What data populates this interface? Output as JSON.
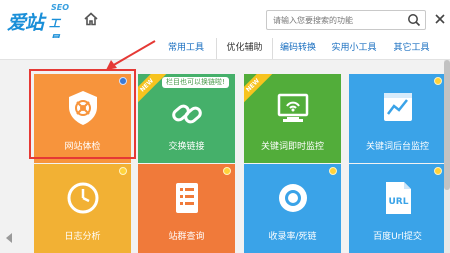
{
  "header": {
    "logo_cn": "爱站",
    "logo_seo": "SEO",
    "logo_sub": "工具包",
    "search_placeholder": "请输入您要搜索的功能"
  },
  "tabs": [
    {
      "label": "常用工具",
      "active": false
    },
    {
      "label": "优化辅助",
      "active": true
    },
    {
      "label": "编码转换",
      "active": false
    },
    {
      "label": "实用小工具",
      "active": false
    },
    {
      "label": "其它工具",
      "active": false
    }
  ],
  "tiles": [
    {
      "label": "网站体检",
      "color": "#f7943c",
      "selected": true
    },
    {
      "label": "交换链接",
      "color": "#45b06a",
      "badge": "NEW",
      "bubble": "栏目也可以换链啦!"
    },
    {
      "label": "关键词即时监控",
      "color": "#52ad3a",
      "badge": "NEW"
    },
    {
      "label": "关键词后台监控",
      "color": "#3aa3e8"
    },
    {
      "label": "日志分析",
      "color": "#f2b134"
    },
    {
      "label": "站群查询",
      "color": "#f07a3a"
    },
    {
      "label": "收录率/死链",
      "color": "#3aa3e8"
    },
    {
      "label": "百度Url提交",
      "color": "#3aa3e8"
    }
  ],
  "colors": {
    "accent": "#1a8fd8",
    "highlight": "#e53935"
  }
}
